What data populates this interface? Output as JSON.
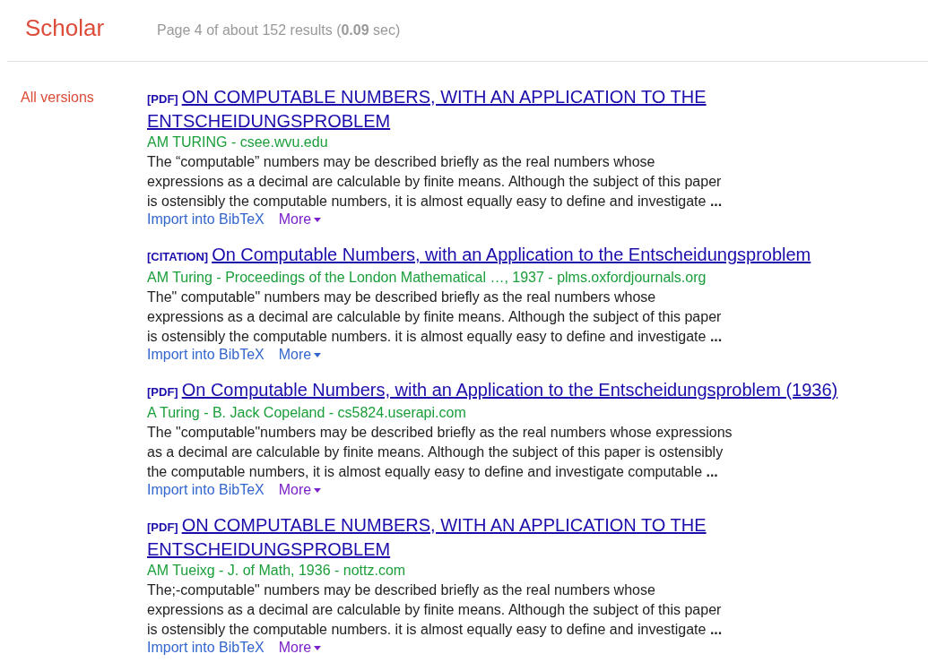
{
  "header": {
    "logo": "Scholar",
    "result_stats": "Page 4 of about 152 results (**0.09** sec)"
  },
  "sidebar": {
    "link": "All versions"
  },
  "results": [
    {
      "tag": "[PDF]",
      "title": "ON COMPUTABLE NUMBERS, WITH AN APPLICATION TO THE\nENTSCHEIDUNGSPROBLEM",
      "meta": "AM TURING - csee.wvu.edu",
      "snippet": "The “computable” numbers may be described briefly as the real numbers whose\nexpressions as a decimal are calculable by finite means. Although the subject of this paper\nis ostensibly the computable numbers, it is almost equally easy to define and investigate **...**",
      "import_link": "Import into BibTeX",
      "more_link": "More",
      "more_visited": true
    },
    {
      "tag": "[CITATION]",
      "title": "On Computable Numbers, with an Application to the Entscheidungsproblem",
      "meta": "AM Turing - Proceedings of the London Mathematical …, 1937 - plms.oxfordjournals.org",
      "snippet": "The\" computable\" numbers may be described briefly as the real numbers whose\nexpressions as a decimal are calculable by finite means. Although the subject of this paper\nis ostensibly the computable numbers. it is almost equally easy to define and investigate **...**",
      "import_link": "Import into BibTeX",
      "more_link": "More",
      "more_visited": false
    },
    {
      "tag": "[PDF]",
      "title": "On Computable Numbers, with an Application to the Entscheidungsproblem (1936)",
      "meta": "A Turing - B. Jack Copeland - cs5824.userapi.com",
      "snippet": "The \"computable\"numbers may be described briefly as the real numbers whose expressions\nas a decimal are calculable by finite means. Although the subject of this paper is ostensibly\nthe computable numbers, it is almost equally easy to define and investigate computable **...**",
      "import_link": "Import into BibTeX",
      "more_link": "More",
      "more_visited": true
    },
    {
      "tag": "[PDF]",
      "title": "ON COMPUTABLE NUMBERS, WITH AN APPLICATION TO THE\nENTSCHEIDUNGSPROBLEM",
      "meta": "AM Tueixg - J. of Math, 1936 - nottz.com",
      "snippet": "The;-computable\" numbers may be described briefly as the real numbers whose\nexpressions as a decimal are calculable by finite means. Although the subject of this paper\nis ostensibly the computable numbers. it is almost equally easy to define and investigate **...**",
      "import_link": "Import into BibTeX",
      "more_link": "More",
      "more_visited": true
    }
  ]
}
